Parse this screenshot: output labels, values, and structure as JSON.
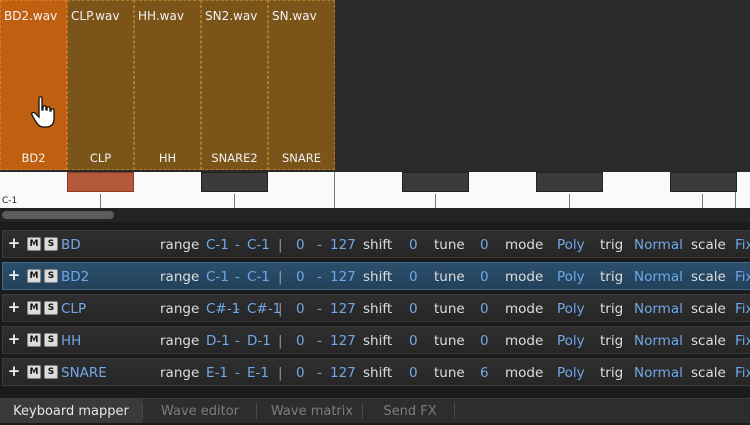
{
  "zones": [
    {
      "file": "BD2.wav",
      "label": "BD2",
      "selected": true
    },
    {
      "file": "CLP.wav",
      "label": "CLP",
      "selected": false
    },
    {
      "file": "HH.wav",
      "label": "HH",
      "selected": false
    },
    {
      "file": "SN2.wav",
      "label": "SNARE2",
      "selected": false
    },
    {
      "file": "SN.wav",
      "label": "SNARE",
      "selected": false
    }
  ],
  "keyboard": {
    "octave_label": "C-1"
  },
  "row_labels": {
    "range": "range",
    "dash": "-",
    "pipe": "|",
    "shift": "shift",
    "tune": "tune",
    "mode": "mode",
    "trig": "trig",
    "scale": "scale"
  },
  "rows": [
    {
      "name": "BD",
      "range_lo": "C-1",
      "range_hi": "C-1",
      "vel_lo": "0",
      "vel_hi": "127",
      "shift": "0",
      "tune": "0",
      "mode": "Poly",
      "trig": "Normal",
      "scale": "Fix",
      "selected": false
    },
    {
      "name": "BD2",
      "range_lo": "C-1",
      "range_hi": "C-1",
      "vel_lo": "0",
      "vel_hi": "127",
      "shift": "0",
      "tune": "0",
      "mode": "Poly",
      "trig": "Normal",
      "scale": "Fix",
      "selected": true
    },
    {
      "name": "CLP",
      "range_lo": "C#-1",
      "range_hi": "C#-1",
      "vel_lo": "0",
      "vel_hi": "127",
      "shift": "0",
      "tune": "0",
      "mode": "Poly",
      "trig": "Normal",
      "scale": "Fix",
      "selected": false
    },
    {
      "name": "HH",
      "range_lo": "D-1",
      "range_hi": "D-1",
      "vel_lo": "0",
      "vel_hi": "127",
      "shift": "0",
      "tune": "0",
      "mode": "Poly",
      "trig": "Normal",
      "scale": "Fix",
      "selected": false
    },
    {
      "name": "SNARE",
      "range_lo": "E-1",
      "range_hi": "E-1",
      "vel_lo": "0",
      "vel_hi": "127",
      "shift": "0",
      "tune": "6",
      "mode": "Poly",
      "trig": "Normal",
      "scale": "Fix",
      "selected": false
    }
  ],
  "row_buttons": {
    "add": "+",
    "mute": "M",
    "solo": "S"
  },
  "tabs": [
    {
      "label": "Keyboard mapper",
      "active": true
    },
    {
      "label": "Wave editor",
      "active": false
    },
    {
      "label": "Wave matrix",
      "active": false
    },
    {
      "label": "Send FX",
      "active": false
    }
  ],
  "colors": {
    "zone_selected": "#bf5f10",
    "zone": "#7a5419",
    "value_blue": "#6fa8ea",
    "row_selected": "#2b4f6c"
  },
  "icons": {
    "cursor": "hand-pointer-icon"
  }
}
